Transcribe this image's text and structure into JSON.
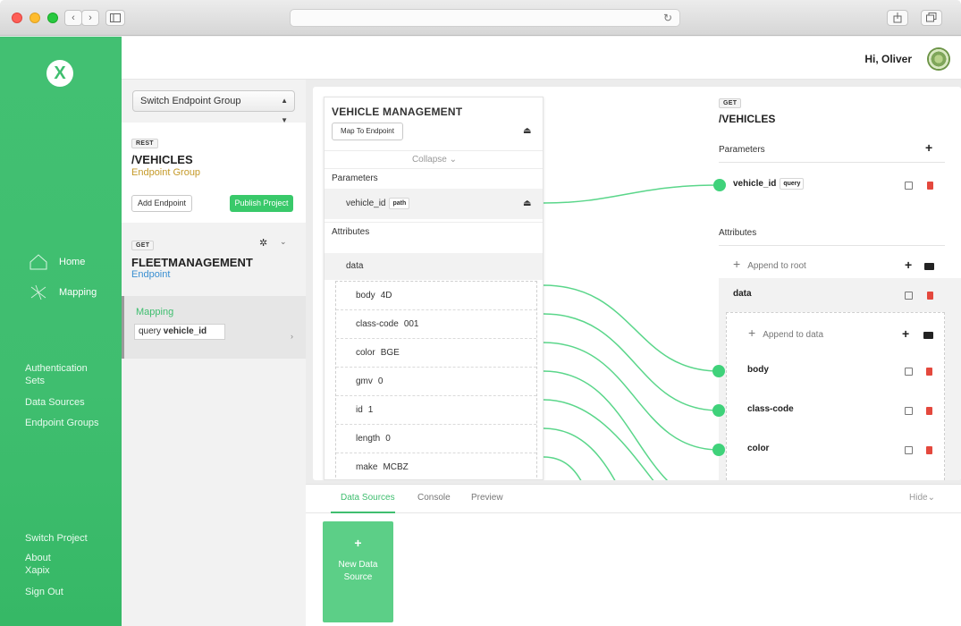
{
  "app": {
    "greeting": "Hi, Oliver",
    "logo_letter": "X"
  },
  "colors": {
    "brand_green": "#3fbe6f",
    "wire_green": "#5ad68a",
    "endpoint_group_orange": "#c59a29",
    "endpoint_blue": "#3a8fd1",
    "delete_red": "#e4483d"
  },
  "sidebar": {
    "main": [
      {
        "label": "Home",
        "icon": "home-icon"
      },
      {
        "label": "Mapping",
        "icon": "mapping-icon"
      }
    ],
    "links": [
      {
        "label": "Authentication Sets"
      },
      {
        "label": "Data Sources"
      },
      {
        "label": "Endpoint Groups"
      }
    ],
    "footer": [
      {
        "label": "Switch Project"
      },
      {
        "label": "About Xapix"
      },
      {
        "label": "Sign Out"
      }
    ]
  },
  "endpoints": {
    "group_select": "Switch Endpoint Group",
    "rest_card": {
      "badge": "REST",
      "path": "/VEHICLES",
      "subtitle": "Endpoint Group",
      "add_label": "Add Endpoint",
      "publish_label": "Publish Project"
    },
    "get_card": {
      "badge": "GET",
      "name": "FLEETMANAGEMENT",
      "subtitle": "Endpoint"
    },
    "mapping_card": {
      "title": "Mapping",
      "query_prefix": "query",
      "query_param": "vehicle_id"
    }
  },
  "source_panel": {
    "title": "VEHICLE MANAGEMENT",
    "map_button": "Map To Endpoint",
    "collapse": "Collapse",
    "parameters_label": "Parameters",
    "param": {
      "name": "vehicle_id",
      "tag": "path"
    },
    "attributes_label": "Attributes",
    "data_label": "data",
    "attributes": [
      {
        "key": "body",
        "value": "4D"
      },
      {
        "key": "class-code",
        "value": "001"
      },
      {
        "key": "color",
        "value": "BGE"
      },
      {
        "key": "gmv",
        "value": "0"
      },
      {
        "key": "id",
        "value": "1"
      },
      {
        "key": "length",
        "value": "0"
      },
      {
        "key": "make",
        "value": "MCBZ"
      }
    ]
  },
  "target_panel": {
    "badge": "GET",
    "path": "/VEHICLES",
    "parameters_label": "Parameters",
    "param": {
      "name": "vehicle_id",
      "tag": "query"
    },
    "attributes_label": "Attributes",
    "append_root": "Append to root",
    "data_label": "data",
    "append_data": "Append to data",
    "fields": [
      {
        "name": "body"
      },
      {
        "name": "class-code"
      },
      {
        "name": "color"
      }
    ]
  },
  "dock": {
    "tabs": [
      {
        "label": "Data Sources",
        "active": true
      },
      {
        "label": "Console",
        "active": false
      },
      {
        "label": "Preview",
        "active": false
      }
    ],
    "hide_label": "Hide",
    "new_ds_plus": "+",
    "new_ds_label": "New Data Source"
  }
}
